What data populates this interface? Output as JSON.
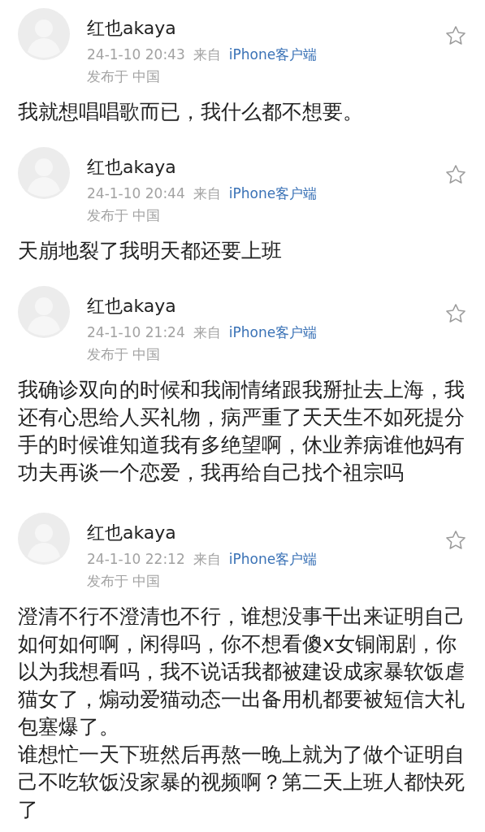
{
  "posts": [
    {
      "author": "红也akaya",
      "time": "24-1-10 20:43",
      "source_prefix": "来自",
      "source": "iPhone客户端",
      "location": "发布于 中国",
      "paragraphs": [
        "我就想唱唱歌而已，我什么都不想要。"
      ]
    },
    {
      "author": "红也akaya",
      "time": "24-1-10 20:44",
      "source_prefix": "来自",
      "source": "iPhone客户端",
      "location": "发布于 中国",
      "paragraphs": [
        "天崩地裂了我明天都还要上班"
      ]
    },
    {
      "author": "红也akaya",
      "time": "24-1-10 21:24",
      "source_prefix": "来自",
      "source": "iPhone客户端",
      "location": "发布于 中国",
      "paragraphs": [
        "我确诊双向的时候和我闹情绪跟我掰扯去上海，我还有心思给人买礼物，病严重了天天生不如死提分手的时候谁知道我有多绝望啊，休业养病谁他妈有功夫再谈一个恋爱，我再给自己找个祖宗吗"
      ]
    },
    {
      "author": "红也akaya",
      "time": "24-1-10 22:12",
      "source_prefix": "来自",
      "source": "iPhone客户端",
      "location": "发布于 中国",
      "paragraphs": [
        "澄清不行不澄清也不行，谁想没事干出来证明自己如何如何啊，闲得吗，你不想看傻x女铜闹剧，你以为我想看吗，我不说话我都被建设成家暴软饭虐猫女了，煽动爱猫动态一出备用机都要被短信大礼包塞爆了。",
        "谁想忙一天下班然后再熬一晚上就为了做个证明自己不吃软饭没家暴的视频啊？第二天上班人都快死了"
      ]
    }
  ]
}
